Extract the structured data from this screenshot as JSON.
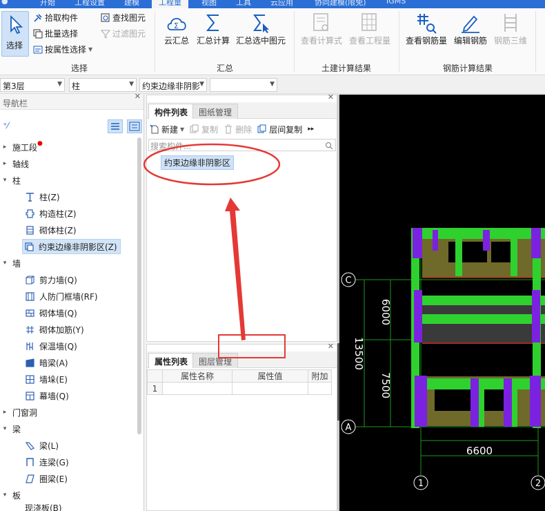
{
  "top_tabs": [
    "开始",
    "工程设置",
    "建模",
    "工程量",
    "视图",
    "工具",
    "云应用",
    "协同建模(限免)",
    "IGMS"
  ],
  "top_tabs_active": "工程量",
  "ribbon": {
    "select_group": {
      "select_label": "选择",
      "pick_component": "拾取构件",
      "batch_select": "批量选择",
      "by_property_select": "按属性选择",
      "find_element": "查找图元",
      "filter_element": "过滤图元",
      "group_label": "选择"
    },
    "summary_group": {
      "cloud_summary": "云汇总",
      "summary_calc": "汇总计算",
      "summary_selected": "汇总选中图元",
      "group_label": "汇总"
    },
    "civil_group": {
      "view_formula": "查看计算式",
      "view_quantity": "查看工程量",
      "group_label": "土建计算结果"
    },
    "rebar_group": {
      "view_rebar_qty": "查看钢筋量",
      "edit_rebar": "编辑钢筋",
      "rebar_3d": "钢筋三维",
      "group_label": "钢筋计算结果"
    }
  },
  "selector_bar": {
    "floor": "第3层",
    "type": "柱",
    "subtype": "约束边缘非阴影",
    "extra": ""
  },
  "nav": {
    "title": "导航栏",
    "items": [
      {
        "label": "施工段",
        "has_dot": true
      },
      {
        "label": "轴线"
      },
      {
        "label": "柱"
      },
      {
        "label": "墙"
      },
      {
        "label": "门窗洞"
      },
      {
        "label": "梁"
      },
      {
        "label": "板"
      }
    ],
    "column_children": [
      "柱(Z)",
      "构造柱(Z)",
      "砌体柱(Z)",
      "约束边缘非阴影区(Z)"
    ],
    "wall_children": [
      "剪力墙(Q)",
      "人防门框墙(RF)",
      "砌体墙(Q)",
      "砌体加筋(Y)",
      "保温墙(Q)",
      "暗梁(A)",
      "墙垛(E)",
      "幕墙(Q)"
    ],
    "beam_children": [
      "梁(L)",
      "连梁(G)",
      "圈梁(E)"
    ],
    "slab_children": [
      "现浇板(B)"
    ]
  },
  "component_panel": {
    "tab_active": "构件列表",
    "tab_other": "图纸管理",
    "toolbar": {
      "new": "新建",
      "copy": "复制",
      "delete": "删除",
      "floor_copy": "层间复制"
    },
    "search_placeholder": "搜索构件...",
    "items": [
      "约束边缘非阴影区"
    ]
  },
  "property_panel": {
    "tab_active": "属性列表",
    "tab_other": "图层管理",
    "headers": [
      "属性名称",
      "属性值",
      "附加"
    ],
    "rows": [
      [
        "1",
        "",
        "",
        ""
      ]
    ]
  },
  "cad": {
    "axes_rows": [
      "C",
      "A"
    ],
    "axes_cols": [
      "1",
      "2"
    ],
    "dims": [
      "6000",
      "7500",
      "13500",
      "6600"
    ]
  },
  "colors": {
    "ribbon_accent": "#2b6fd6",
    "annotation_red": "#e53935",
    "beam_green": "#2fd12f",
    "column_purple": "#7b22e0",
    "slab_olive": "#6f6a2a"
  }
}
